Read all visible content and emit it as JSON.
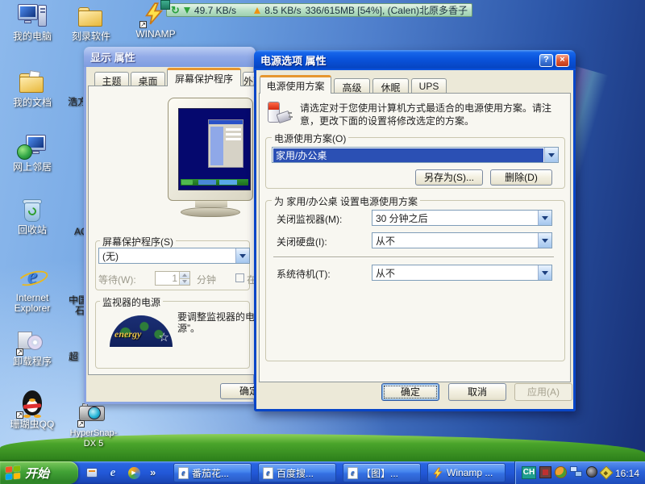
{
  "net_bar": {
    "down_value": "49.7 KB/s",
    "up_value": "8.5 KB/s",
    "info": "336/615MB [54%], (Calen)北原多香子"
  },
  "desktop_icons": {
    "col1": [
      {
        "label": "我的电脑"
      },
      {
        "label": "我的文档"
      },
      {
        "label": "网上邻居"
      },
      {
        "label": "回收站"
      },
      {
        "label": "Internet Explorer"
      },
      {
        "label": "卸载程序"
      },
      {
        "label": "珊瑚虫QQ"
      }
    ],
    "col2": [
      {
        "label": "刻录软件"
      },
      {
        "label": "WINAMP"
      },
      {
        "label": "浩方"
      },
      {
        "label": "AC"
      },
      {
        "label": "中国",
        "label2": "石"
      },
      {
        "label": "超"
      },
      {
        "label": "HyperSnap-DX 5"
      }
    ]
  },
  "display_dialog": {
    "title": "显示 属性",
    "tabs": [
      {
        "label": "主题"
      },
      {
        "label": "桌面"
      },
      {
        "label": "屏幕保护程序"
      },
      {
        "label": "外观"
      }
    ],
    "screensaver_group": "屏幕保护程序(S)",
    "screensaver_value": "(无)",
    "wait_label": "等待(W):",
    "wait_value": "1",
    "minutes_label": "分钟",
    "checkbox_label": "在",
    "monitor_power_group": "监视器的电源",
    "monitor_power_text": "要调整监视器的电源”。",
    "energy_logo_text": "energy",
    "ok_label": "确定"
  },
  "power_dialog": {
    "title": "电源选项 属性",
    "help_label": "?",
    "close_label": "×",
    "tabs": [
      {
        "label": "电源使用方案"
      },
      {
        "label": "高级"
      },
      {
        "label": "休眠"
      },
      {
        "label": "UPS"
      }
    ],
    "description": "请选定对于您使用计算机方式最适合的电源使用方案。请注意，更改下面的设置将修改选定的方案。",
    "scheme_group_label": "电源使用方案(O)",
    "scheme_value": "家用/办公桌",
    "save_as_label": "另存为(S)...",
    "delete_label": "删除(D)",
    "settings_group_label": "为 家用/办公桌 设置电源使用方案",
    "rows": [
      {
        "label": "关闭监视器(M):",
        "value": "30 分钟之后"
      },
      {
        "label": "关闭硬盘(I):",
        "value": "从不"
      },
      {
        "label": "系统待机(T):",
        "value": "从不"
      }
    ],
    "ok_label": "确定",
    "cancel_label": "取消",
    "apply_label": "应用(A)"
  },
  "taskbar": {
    "start_label": "开始",
    "quick_launch_more": "»",
    "tasks": [
      {
        "label": "番茄花..."
      },
      {
        "label": "百度搜..."
      },
      {
        "label": "【图】..."
      },
      {
        "label": "Winamp ..."
      }
    ],
    "tray": {
      "lang": "CH",
      "time": "16:14"
    }
  }
}
